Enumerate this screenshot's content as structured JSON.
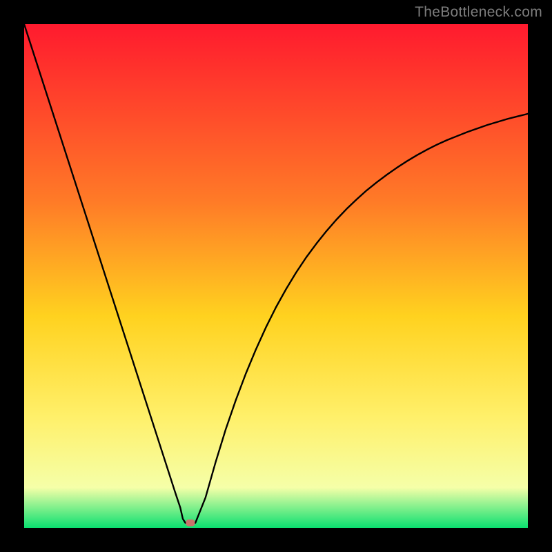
{
  "watermark": "TheBottleneck.com",
  "colors": {
    "frame": "#000000",
    "gradient_top": "#ff1a2e",
    "gradient_mid1": "#ff7a27",
    "gradient_mid2": "#ffd21f",
    "gradient_mid3": "#fff06a",
    "gradient_mid4": "#f5ffa8",
    "gradient_bottom": "#0be070",
    "curve": "#000000",
    "dot": "#c9736b"
  },
  "chart_data": {
    "type": "line",
    "title": "",
    "xlabel": "",
    "ylabel": "",
    "xlim": [
      0,
      100
    ],
    "ylim": [
      0,
      100
    ],
    "x": [
      0,
      2,
      4,
      6,
      8,
      10,
      12,
      14,
      16,
      18,
      20,
      22,
      24,
      26,
      28,
      30,
      31,
      31.5,
      32,
      32.5,
      33,
      33.5,
      34,
      36,
      38,
      40,
      42,
      44,
      46,
      48,
      50,
      52,
      54,
      56,
      58,
      60,
      62,
      64,
      66,
      68,
      70,
      72,
      74,
      76,
      78,
      80,
      82,
      84,
      86,
      88,
      90,
      92,
      94,
      96,
      98,
      100
    ],
    "values": [
      100,
      93.8,
      87.6,
      81.4,
      75.2,
      69,
      62.8,
      56.6,
      50.4,
      44.2,
      38,
      31.8,
      25.6,
      19.4,
      13.2,
      7,
      4,
      1.8,
      1,
      1,
      1,
      1,
      1,
      6,
      13,
      19.5,
      25.3,
      30.6,
      35.4,
      39.8,
      43.8,
      47.4,
      50.7,
      53.7,
      56.4,
      58.9,
      61.2,
      63.3,
      65.2,
      67,
      68.6,
      70.1,
      71.5,
      72.8,
      74,
      75.1,
      76.1,
      77,
      77.8,
      78.6,
      79.3,
      80,
      80.6,
      81.2,
      81.7,
      82.2
    ],
    "marker": {
      "x": 33,
      "y": 1
    },
    "bottom_flat": {
      "x0": 31,
      "x1": 33.5,
      "y": 1
    },
    "annotations": [
      "TheBottleneck.com"
    ]
  }
}
